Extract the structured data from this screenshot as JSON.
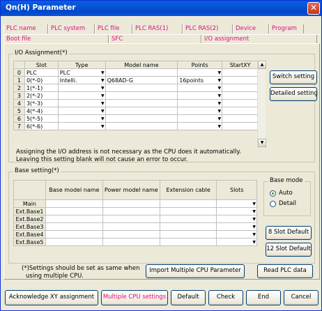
{
  "window": {
    "title": "Qn(H) Parameter"
  },
  "tabs": {
    "back_row": [
      "PLC name",
      "PLC system",
      "PLC file",
      "PLC RAS(1)",
      "PLC RAS(2)",
      "Device",
      "Program"
    ],
    "front_row": [
      "Boot file",
      "SFC",
      "I/O assignment"
    ]
  },
  "io_assignment": {
    "group_label": "I/O Assignment(*)",
    "columns": [
      "Slot",
      "Type",
      "Model name",
      "Points",
      "StartXY"
    ],
    "rows": [
      {
        "num": "0",
        "slot": "PLC",
        "type": "PLC",
        "model": "",
        "points": "",
        "start": ""
      },
      {
        "num": "1",
        "slot": "0(*-0)",
        "type": "Intelli.",
        "model": "Q68AD-G",
        "points": "16points",
        "start": ""
      },
      {
        "num": "2",
        "slot": "1(*-1)",
        "type": "",
        "model": "",
        "points": "",
        "start": ""
      },
      {
        "num": "3",
        "slot": "2(*-2)",
        "type": "",
        "model": "",
        "points": "",
        "start": ""
      },
      {
        "num": "4",
        "slot": "3(*-3)",
        "type": "",
        "model": "",
        "points": "",
        "start": ""
      },
      {
        "num": "5",
        "slot": "4(*-4)",
        "type": "",
        "model": "",
        "points": "",
        "start": ""
      },
      {
        "num": "6",
        "slot": "5(*-5)",
        "type": "",
        "model": "",
        "points": "",
        "start": ""
      },
      {
        "num": "7",
        "slot": "6(*-6)",
        "type": "",
        "model": "",
        "points": "",
        "start": ""
      }
    ],
    "note1": "Assigning the I/O address is not necessary as the CPU does it automatically.",
    "note2": "Leaving this setting blank will not cause an error to occur.",
    "switch_setting": "Switch setting",
    "detailed_setting": "Detailed setting"
  },
  "base_setting": {
    "group_label": "Base setting(*)",
    "columns": [
      "Base model name",
      "Power model name",
      "Extension cable",
      "Slots"
    ],
    "rows": [
      "Main",
      "Ext.Base1",
      "Ext.Base2",
      "Ext.Base3",
      "Ext.Base4",
      "Ext.Base5"
    ],
    "base_mode_label": "Base mode",
    "auto": "Auto",
    "detail": "Detail",
    "slot8": "8 Slot Default",
    "slot12": "12 Slot Default"
  },
  "footer": {
    "note_line1": "(*)Settings should be set as same when",
    "note_line2": "using multiple CPU.",
    "import_btn": "Import Multiple CPU Parameter",
    "read_plc": "Read PLC data"
  },
  "bottom_buttons": {
    "ack": "Acknowledge XY assignment",
    "multi_cpu": "Multiple CPU settings",
    "default": "Default",
    "check": "Check",
    "end": "End",
    "cancel": "Cancel"
  }
}
